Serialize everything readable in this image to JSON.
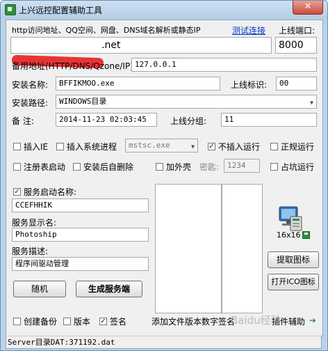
{
  "window": {
    "title": "上兴远控配置辅助工具",
    "close_label": "✕"
  },
  "row_http": {
    "label": "http访问地址、QQ空间、网盘、DNS域名解析或静态IP",
    "test_link": "测试连接",
    "port_label": "上线端口:",
    "address_value": ".net",
    "port_value": "8000"
  },
  "backup": {
    "label": "备用地址(HTTP/DNS/Qzone/IP):",
    "value": "127.0.0.1"
  },
  "install_name": {
    "label": "安装名称:",
    "value": "BFFIKMOO.exe",
    "mark_label": "上线标识:",
    "mark_value": "00"
  },
  "install_path": {
    "label": "安装路径:",
    "value": "WINDOWS目录"
  },
  "note": {
    "label": "备  注:",
    "value": "2014-11-23 02:03:45",
    "group_label": "上线分组:",
    "group_value": "11"
  },
  "options_row1": {
    "insert_ie": "插入IE",
    "insert_process": "插入系统进程",
    "process_value": "mstsc.exe",
    "no_insert": "不插入运行",
    "normal_run": "正规运行"
  },
  "options_row2": {
    "registry": "注册表启动",
    "self_delete": "安装后自删除",
    "pack": "加外壳",
    "password_label": "密匙:",
    "password_value": "1234",
    "occupy": "占坑运行"
  },
  "service": {
    "start_name_label": "服务启动名称:",
    "start_name_value": "CCEFHHIK",
    "display_label": "服务显示名:",
    "display_value": "Photoship",
    "desc_label": "服务描述:",
    "desc_value": "程序间驱动管理",
    "random_button": "随机",
    "generate_button": "生成服务端"
  },
  "icon_panel": {
    "size_label": "16x16",
    "extract_button": "提取图标",
    "open_button": "打开ICO图标"
  },
  "bottom": {
    "backup": "创建备份",
    "version": "版本",
    "sign": "签名",
    "add_version": "添加文件版本数字签名",
    "help_link": "插件辅助"
  },
  "status": {
    "text": "Server目录DAT:371192.dat"
  },
  "watermark": "Baidu经验",
  "colors": {
    "accent_green": "#2f8f3e",
    "redaction": "#e83434"
  }
}
